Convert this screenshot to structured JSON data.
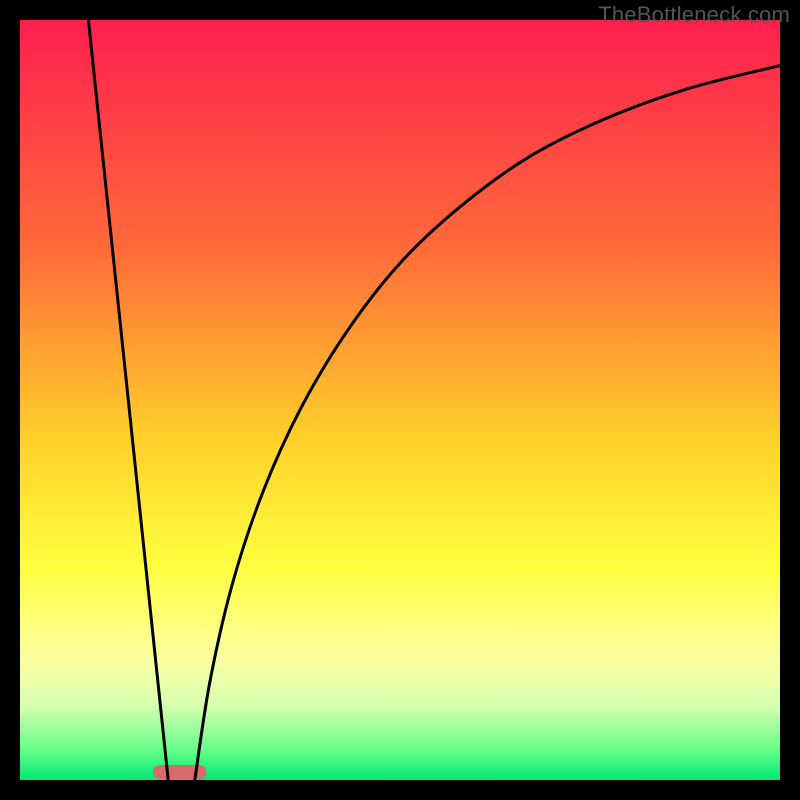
{
  "watermark": "TheBottleneck.com",
  "chart_data": {
    "type": "line",
    "title": "",
    "xlabel": "",
    "ylabel": "",
    "xlim": [
      0,
      100
    ],
    "ylim": [
      0,
      100
    ],
    "grid": false,
    "legend": false,
    "series": [
      {
        "name": "left-branch",
        "x": [
          9,
          19.5
        ],
        "y": [
          100,
          0
        ]
      },
      {
        "name": "right-branch",
        "x": [
          23,
          25,
          28,
          32,
          37,
          43,
          50,
          58,
          67,
          77,
          88,
          100
        ],
        "y": [
          0,
          13,
          26,
          38,
          49,
          59,
          68,
          75.5,
          82,
          87,
          91,
          94
        ]
      }
    ],
    "marker": {
      "name": "optimal-zone",
      "x_center": 21,
      "width": 7,
      "color": "#d96a6a"
    },
    "background_gradient": {
      "stops": [
        {
          "pos": 0.0,
          "color": "#ff1e4e"
        },
        {
          "pos": 0.3,
          "color": "#ff6a3a"
        },
        {
          "pos": 0.55,
          "color": "#ffd02a"
        },
        {
          "pos": 0.72,
          "color": "#ffff40"
        },
        {
          "pos": 0.84,
          "color": "#fbffa0"
        },
        {
          "pos": 0.9,
          "color": "#d8ffb0"
        },
        {
          "pos": 0.96,
          "color": "#66ff8a"
        },
        {
          "pos": 1.0,
          "color": "#00e874"
        }
      ]
    }
  }
}
